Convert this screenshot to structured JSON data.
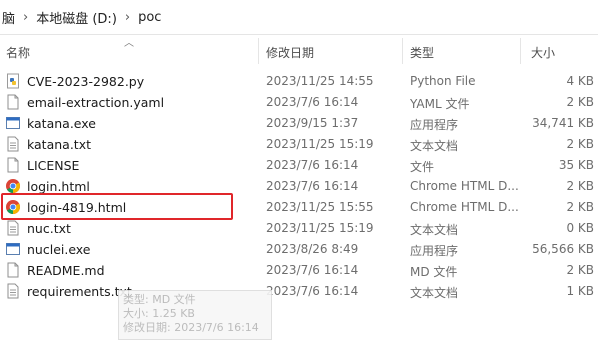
{
  "breadcrumb": {
    "parts": [
      "脑",
      "本地磁盘 (D:)",
      "poc"
    ],
    "separator": "›"
  },
  "columns": {
    "name": "名称",
    "date": "修改日期",
    "type": "类型",
    "size": "大小"
  },
  "files": [
    {
      "name": "CVE-2023-2982.py",
      "date": "2023/11/25 14:55",
      "type": "Python File",
      "size": "4 KB",
      "icon": "python-file-icon"
    },
    {
      "name": "email-extraction.yaml",
      "date": "2023/7/6 16:14",
      "type": "YAML 文件",
      "size": "2 KB",
      "icon": "document-icon"
    },
    {
      "name": "katana.exe",
      "date": "2023/9/15 1:37",
      "type": "应用程序",
      "size": "34,741 KB",
      "icon": "exe-icon"
    },
    {
      "name": "katana.txt",
      "date": "2023/11/25 15:19",
      "type": "文本文档",
      "size": "2 KB",
      "icon": "text-file-icon"
    },
    {
      "name": "LICENSE",
      "date": "2023/7/6 16:14",
      "type": "文件",
      "size": "35 KB",
      "icon": "document-icon"
    },
    {
      "name": "login.html",
      "date": "2023/7/6 16:14",
      "type": "Chrome HTML D...",
      "size": "2 KB",
      "icon": "chrome-icon"
    },
    {
      "name": "login-4819.html",
      "date": "2023/11/25 15:55",
      "type": "Chrome HTML D...",
      "size": "2 KB",
      "icon": "chrome-icon"
    },
    {
      "name": "nuc.txt",
      "date": "2023/11/25 15:19",
      "type": "文本文档",
      "size": "0 KB",
      "icon": "text-file-icon"
    },
    {
      "name": "nuclei.exe",
      "date": "2023/8/26 8:49",
      "type": "应用程序",
      "size": "56,566 KB",
      "icon": "exe-icon"
    },
    {
      "name": "README.md",
      "date": "2023/7/6 16:14",
      "type": "MD 文件",
      "size": "2 KB",
      "icon": "document-icon"
    },
    {
      "name": "requirements.txt",
      "date": "2023/7/6 16:14",
      "type": "文本文档",
      "size": "1 KB",
      "icon": "text-file-icon"
    }
  ],
  "tooltip": {
    "line1": "类型: MD 文件",
    "line2": "大小: 1.25 KB",
    "line3": "修改日期: 2023/7/6 16:14"
  },
  "colors": {
    "highlight": "#e0262a",
    "text": "#1a1a1a",
    "muted": "#6d6d6d"
  }
}
